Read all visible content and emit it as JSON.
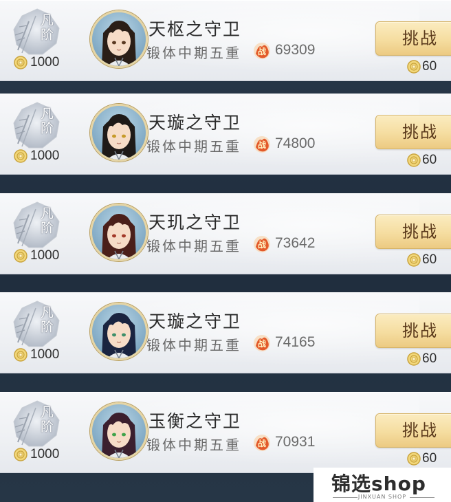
{
  "opponents": [
    {
      "rank_label": "凡阶",
      "rank_value": "1000",
      "name": "天枢之守卫",
      "realm": "锻体中期五重",
      "power": "69309",
      "challenge_label": "挑战",
      "cost": "60",
      "avatar_hair": "#2a1e17",
      "avatar_eye": "#5a3a22"
    },
    {
      "rank_label": "凡阶",
      "rank_value": "1000",
      "name": "天璇之守卫",
      "realm": "锻体中期五重",
      "power": "74800",
      "challenge_label": "挑战",
      "cost": "60",
      "avatar_hair": "#1e1a18",
      "avatar_eye": "#c79a2a"
    },
    {
      "rank_label": "凡阶",
      "rank_value": "1000",
      "name": "天玑之守卫",
      "realm": "锻体中期五重",
      "power": "73642",
      "challenge_label": "挑战",
      "cost": "60",
      "avatar_hair": "#4a1f1a",
      "avatar_eye": "#a33a2a"
    },
    {
      "rank_label": "凡阶",
      "rank_value": "1000",
      "name": "天璇之守卫",
      "realm": "锻体中期五重",
      "power": "74165",
      "challenge_label": "挑战",
      "cost": "60",
      "avatar_hair": "#1a2440",
      "avatar_eye": "#3f8f6a"
    },
    {
      "rank_label": "凡阶",
      "rank_value": "1000",
      "name": "玉衡之守卫",
      "realm": "锻体中期五重",
      "power": "70931",
      "challenge_label": "挑战",
      "cost": "60",
      "avatar_hair": "#3b1f2e",
      "avatar_eye": "#3fa34a"
    }
  ],
  "power_icon_label": "战",
  "watermark": {
    "brand": "锦选shop",
    "sub": "JINXUAN SHOP"
  },
  "icons": {
    "rank": "rank-badge-icon",
    "coin": "coin-icon",
    "power": "power-icon"
  }
}
